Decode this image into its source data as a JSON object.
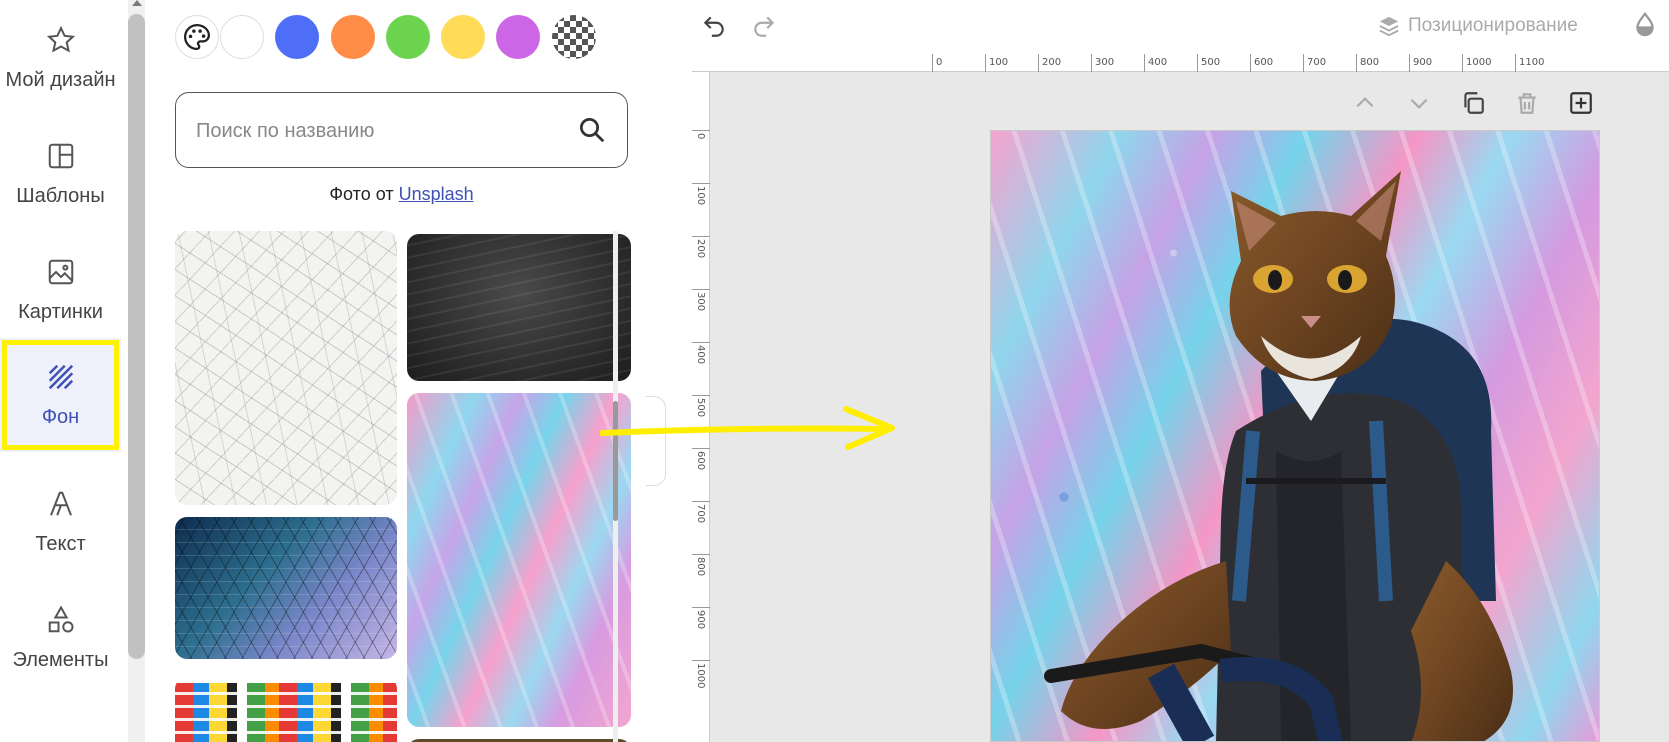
{
  "sidebar": {
    "items": [
      {
        "label": "Мой дизайн",
        "icon": "star-icon"
      },
      {
        "label": "Шаблоны",
        "icon": "templates-icon"
      },
      {
        "label": "Картинки",
        "icon": "image-icon"
      },
      {
        "label": "Фон",
        "icon": "background-icon",
        "active": true
      },
      {
        "label": "Текст",
        "icon": "text-icon"
      },
      {
        "label": "Элементы",
        "icon": "shapes-icon"
      }
    ]
  },
  "background_panel": {
    "swatches": [
      {
        "name": "white",
        "color": "#ffffff"
      },
      {
        "name": "blue",
        "color": "#4f6ef7"
      },
      {
        "name": "orange",
        "color": "#ff8c47"
      },
      {
        "name": "green",
        "color": "#6cd44f"
      },
      {
        "name": "yellow",
        "color": "#ffdb58"
      },
      {
        "name": "purple",
        "color": "#cc66e6"
      },
      {
        "name": "transparent",
        "color": "checker"
      }
    ],
    "search": {
      "placeholder": "Поиск по названию",
      "value": ""
    },
    "credit": {
      "prefix": "Фото от",
      "link": "Unsplash"
    }
  },
  "editor": {
    "toolbar": {
      "positioning_label": "Позиционирование"
    },
    "ruler_h": [
      "0",
      "100",
      "200",
      "300",
      "400",
      "500",
      "600",
      "700",
      "800",
      "900",
      "1000",
      "1100"
    ],
    "ruler_v": [
      "0",
      "100",
      "200",
      "300",
      "400",
      "500",
      "600",
      "700",
      "800",
      "900",
      "1000"
    ]
  },
  "colors": {
    "accent": "#3f51b5",
    "highlight": "#fff200",
    "annotation_arrow": "#ffee00"
  }
}
